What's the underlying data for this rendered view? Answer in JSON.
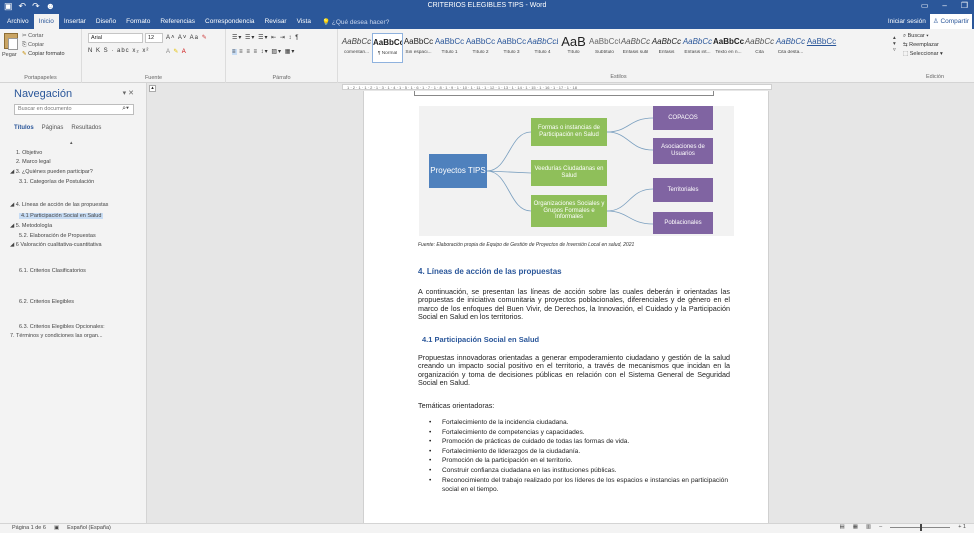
{
  "window": {
    "title": "CRITERIOS ELEGIBLES TIPS - Word",
    "qat": [
      "save-icon",
      "undo-icon",
      "redo-icon",
      "user-icon"
    ],
    "controls": [
      "ribbon-display-icon",
      "minimize-icon",
      "restore-icon"
    ]
  },
  "tabs": {
    "items": [
      "Archivo",
      "Inicio",
      "Insertar",
      "Diseño",
      "Formato",
      "Referencias",
      "Correspondencia",
      "Revisar",
      "Vista"
    ],
    "active": "Inicio",
    "tell_me": "¿Qué desea hacer?",
    "signin": "Iniciar sesión",
    "share": "Compartir"
  },
  "ribbon": {
    "clipboard": {
      "paste": "Pegar",
      "cut": "Cortar",
      "copy": "Copiar",
      "format_painter": "Copiar formato",
      "label": "Portapapeles"
    },
    "font": {
      "name": "Arial",
      "size": "12",
      "row2": "N  K  S  ·  abc  x₂  x²",
      "label": "Fuente"
    },
    "paragraph": {
      "label": "Párrafo"
    },
    "styles": {
      "label": "Estilos",
      "items": [
        {
          "preview": "AaBbCc",
          "name": "comentari..."
        },
        {
          "preview": "AaBbCc",
          "name": "¶ Normal"
        },
        {
          "preview": "AaBbCc",
          "name": "Sin espaci..."
        },
        {
          "preview": "AaBbCc",
          "name": "Título 1"
        },
        {
          "preview": "AaBbCc",
          "name": "Título 2"
        },
        {
          "preview": "AaBbCc",
          "name": "Título 3"
        },
        {
          "preview": "AaBbCcD",
          "name": "Título 4"
        },
        {
          "preview": "AaB",
          "name": "Título"
        },
        {
          "preview": "AaBbCcC",
          "name": "Subtítulo"
        },
        {
          "preview": "AaBbCc",
          "name": "Énfasis sutil"
        },
        {
          "preview": "AaBbCc",
          "name": "Énfasis"
        },
        {
          "preview": "AaBbCc",
          "name": "Énfasis int..."
        },
        {
          "preview": "AaBbCc",
          "name": "Texto en n..."
        },
        {
          "preview": "AaBbCc",
          "name": "Cita"
        },
        {
          "preview": "AaBbCc",
          "name": "Cita desta..."
        },
        {
          "preview": "AaBbCc",
          "name": ""
        }
      ]
    },
    "editing": {
      "find": "Buscar",
      "replace": "Reemplazar",
      "select": "Seleccionar",
      "label": "Edición"
    }
  },
  "ruler": {
    "ticks": "1 · 2 · 1 · 1 · 2 · 1 · 3 · 1 · 4 · 1 · 5 · 1 · 6 · 1 · 7 · 1 · 8 · 1 · 9 · 1 · 10 · 1 · 11 · 1 · 12 · 1 · 13 · 1 · 14 · 1 · 15 · 1 · 16 · 1 · 17 · 1 · 18"
  },
  "nav": {
    "title": "Navegación",
    "search_placeholder": "Buscar en documento",
    "tabs": [
      "Títulos",
      "Páginas",
      "Resultados"
    ],
    "items": [
      "1. Objetivo",
      "2. Marco legal",
      "◢ 3. ¿Quiénes pueden participar?",
      "3.1. Categorías de Postulación",
      "◢ 4. Líneas de acción de las propuestas",
      "4.1 Participación Social en Salud",
      "◢ 5. Metodología",
      "5.2. Elaboración de Propuestas",
      "◢ 6 Valoración cualitativa-cuantitativa",
      "6.1. Criterios Clasificatorios",
      "6.2. Criterios Elegibles",
      "6.3. Criterios Elegibles Opcionales:",
      "7. Términos y condiciones las organ..."
    ]
  },
  "diagram": {
    "root": "Proyectos TIPS",
    "mid": [
      "Formas o instancias de Participación en Salud",
      "Veedurías Ciudadanas en Salud",
      "Organizaciones Sociales y Grupos Formales e Informales"
    ],
    "leaves": [
      "COPACOS",
      "Asociaciones de Usuarios",
      "Territoriales",
      "Poblacionales"
    ]
  },
  "document": {
    "caption": "Fuente: Elaboración propia de Equipo de Gestión de Proyectos de Inversión Local en salud, 2021",
    "h1": "4. Líneas de acción de las propuestas",
    "p1": "A continuación, se presentan las líneas de acción sobre las cuales deberán ir orientadas las propuestas de iniciativa comunitaria y proyectos poblacionales, diferenciales y de género en el marco de los enfoques del Buen Vivir, de Derechos, la Innovación, el Cuidado y la Participación Social en Salud en los territorios.",
    "h2": "4.1 Participación Social en Salud",
    "p2": "Propuestas innovadoras orientadas a generar empoderamiento ciudadano y gestión de la salud creando un impacto social positivo en el territorio, a través de mecanismos que incidan en la organización y toma de decisiones públicas en relación con el Sistema General de Seguridad Social en Salud.",
    "p3": "Temáticas orientadoras:",
    "bullets": [
      "Fortalecimiento de la incidencia ciudadana.",
      "Fortalecimiento de competencias y capacidades.",
      "Promoción de prácticas de cuidado de todas las formas de vida.",
      "Fortalecimiento de liderazgos de la ciudadanía.",
      "Promoción de la participación en el territorio.",
      "Construir confianza ciudadana en las instituciones públicas.",
      "Reconocimiento del trabajo realizado por los líderes de los espacios e instancias en participación social en el tiempo."
    ]
  },
  "status": {
    "page": "Página 1 de 6",
    "lang": "Español (España)",
    "zoom_label": "+ 1"
  }
}
